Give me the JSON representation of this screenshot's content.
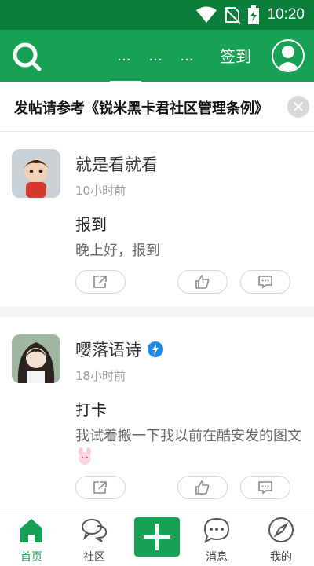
{
  "status_bar": {
    "time": "10:20"
  },
  "app_bar": {
    "tabs": [
      "...",
      "...",
      "..."
    ],
    "signin_label": "签到"
  },
  "notice": {
    "text": "发帖请参考《锐米黑卡君社区管理条例》",
    "close": "✕"
  },
  "posts": [
    {
      "user": "就是看就看",
      "time": "10小时前",
      "title": "报到",
      "body": "晚上好，报到",
      "verified": false
    },
    {
      "user": "嘤落语诗",
      "time": "18小时前",
      "title": "打卡",
      "body": "我试着搬一下我以前在酷安发的图文",
      "verified": true
    }
  ],
  "bottom_nav": [
    {
      "label": "首页",
      "icon": "home-icon",
      "active": true
    },
    {
      "label": "社区",
      "icon": "chat-bubbles-icon",
      "active": false
    },
    {
      "label": "",
      "icon": "plus-icon",
      "active": false
    },
    {
      "label": "消息",
      "icon": "message-icon",
      "active": false
    },
    {
      "label": "我的",
      "icon": "compass-icon",
      "active": false
    }
  ],
  "colors": {
    "primary": "#16a155",
    "status_bar": "#0b7e3c"
  }
}
